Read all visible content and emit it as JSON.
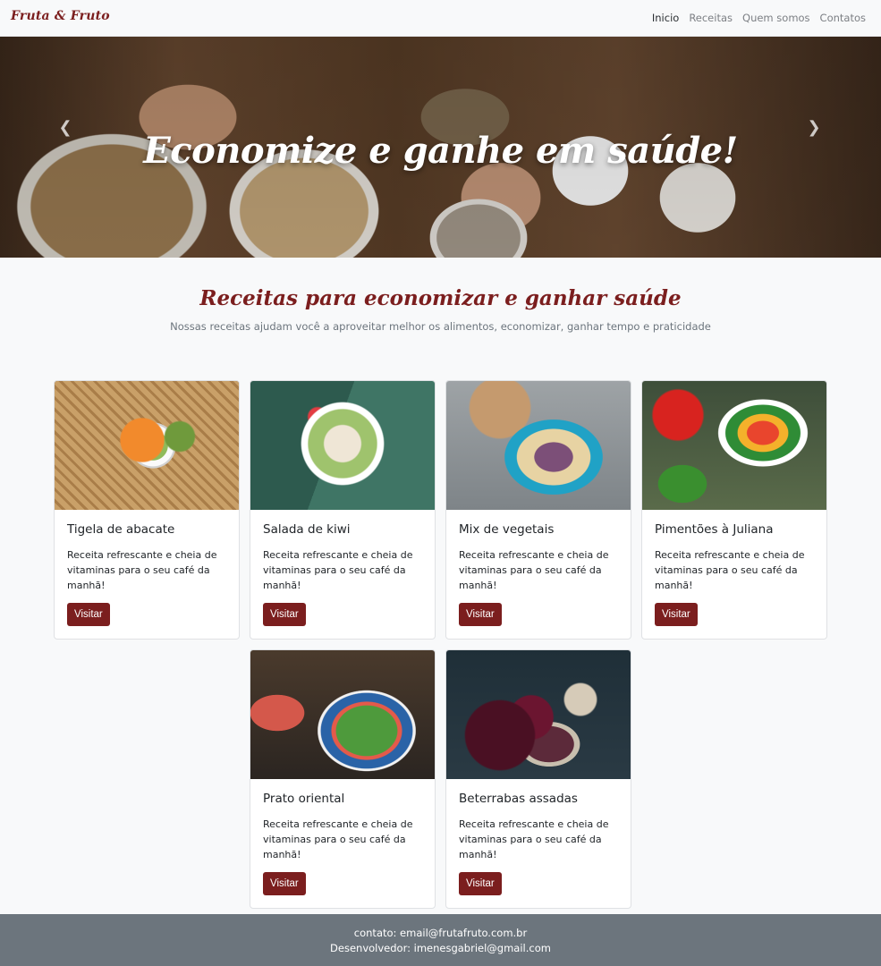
{
  "navbar": {
    "brand": "Fruta & Fruto",
    "links": [
      "Inicio",
      "Receitas",
      "Quem somos",
      "Contatos"
    ],
    "active_link": "Inicio"
  },
  "hero": {
    "title": "Economize e ganhe em saúde!",
    "prev_icon": "chevron-left-icon",
    "next_icon": "chevron-right-icon"
  },
  "section": {
    "title": "Receitas para economizar e ganhar saúde",
    "subtitle": "Nossas receitas ajudam você a aproveitar melhor os alimentos, economizar, ganhar tempo e praticidade"
  },
  "cards": [
    {
      "title": "Tigela de abacate",
      "text": "Receita refrescante e cheia de vitaminas para o seu café da manhã!",
      "button": "Visitar"
    },
    {
      "title": "Salada de kiwi",
      "text": "Receita refrescante e cheia de vitaminas para o seu café da manhã!",
      "button": "Visitar"
    },
    {
      "title": "Mix de vegetais",
      "text": "Receita refrescante e cheia de vitaminas para o seu café da manhã!",
      "button": "Visitar"
    },
    {
      "title": "Pimentões à Juliana",
      "text": "Receita refrescante e cheia de vitaminas para o seu café da manhã!",
      "button": "Visitar"
    },
    {
      "title": "Prato oriental",
      "text": "Receita refrescante e cheia de vitaminas para o seu café da manhã!",
      "button": "Visitar"
    },
    {
      "title": "Beterrabas assadas",
      "text": "Receita refrescante e cheia de vitaminas para o seu café da manhã!",
      "button": "Visitar"
    }
  ],
  "footer": {
    "contact": "contato: email@frutafruto.com.br",
    "developer": "Desenvolvedor: imenesgabriel@gmail.com"
  },
  "colors": {
    "brand": "#7b1e1e",
    "footer_bg": "#6c757d",
    "page_bg": "#f8f9fa"
  }
}
